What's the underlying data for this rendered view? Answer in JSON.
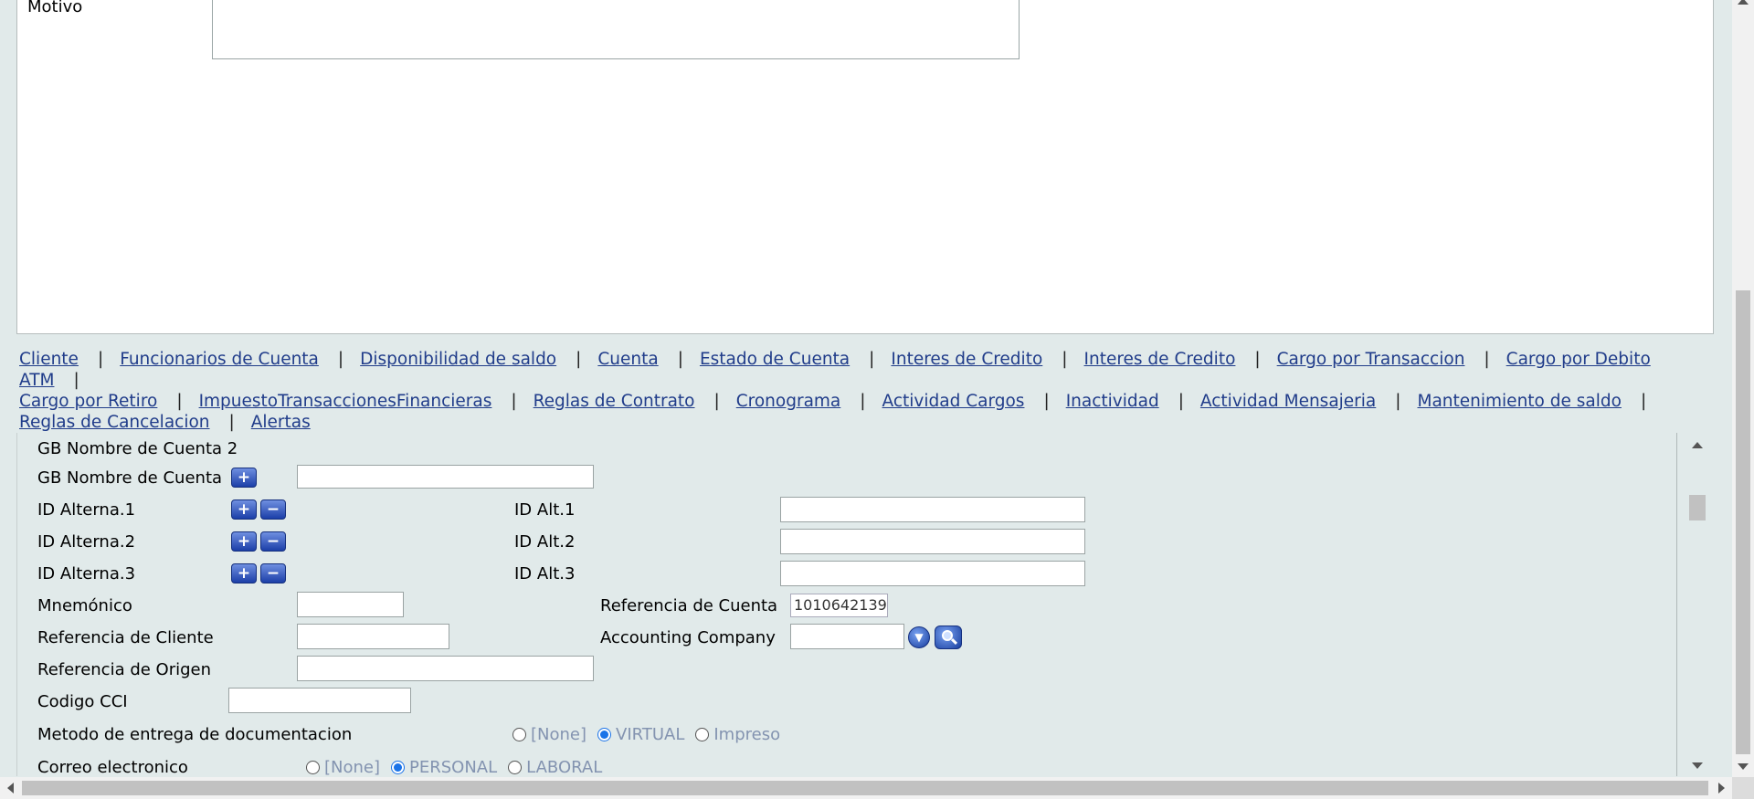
{
  "motivo": {
    "label": "Motivo",
    "value": ""
  },
  "links": [
    "Cliente",
    "Funcionarios de Cuenta",
    "Disponibilidad de saldo",
    "Cuenta",
    "Estado de Cuenta",
    "Interes de Credito",
    "Interes de Credito",
    "Cargo por Transaccion",
    "Cargo por Debito ATM",
    "Cargo por Retiro",
    "ImpuestoTransaccionesFinancieras",
    "Reglas de Contrato",
    "Cronograma",
    "Actividad Cargos",
    "Inactividad",
    "Actividad Mensajeria",
    "Mantenimiento de saldo",
    "Reglas de Cancelacion",
    "Alertas"
  ],
  "link_separator": "|",
  "form": {
    "gb_nombre_cuenta_2": "GB Nombre de Cuenta 2",
    "gb_nombre_cuenta": {
      "label": "GB Nombre de Cuenta",
      "value": ""
    },
    "id_alterna_1": {
      "label": "ID Alterna.1",
      "alt_label": "ID Alt.1",
      "value": ""
    },
    "id_alterna_2": {
      "label": "ID Alterna.2",
      "alt_label": "ID Alt.2",
      "value": ""
    },
    "id_alterna_3": {
      "label": "ID Alterna.3",
      "alt_label": "ID Alt.3",
      "value": ""
    },
    "mnemonico": {
      "label": "Mnemónico",
      "value": ""
    },
    "referencia_cuenta": {
      "label": "Referencia de Cuenta",
      "value": "1010642139"
    },
    "referencia_cliente": {
      "label": "Referencia de Cliente",
      "value": ""
    },
    "accounting_company": {
      "label": "Accounting Company",
      "value": ""
    },
    "referencia_origen": {
      "label": "Referencia de Origen",
      "value": ""
    },
    "codigo_cci": {
      "label": "Codigo CCI",
      "value": ""
    },
    "metodo_entrega": {
      "label": "Metodo de entrega de documentacion",
      "options": [
        "[None]",
        "VIRTUAL",
        "Impreso"
      ],
      "selected": "VIRTUAL"
    },
    "correo": {
      "label": "Correo electronico",
      "options": [
        "[None]",
        "PERSONAL",
        "LABORAL"
      ],
      "selected": "PERSONAL"
    }
  },
  "icons": {
    "add": "plus-icon",
    "remove": "minus-icon",
    "dropdown": "chevron-down-icon",
    "search": "search-icon"
  },
  "colors": {
    "background": "#e1eaea",
    "link": "#203c8a",
    "button": "#1c3fa8",
    "radio_selected": "#1a73e8",
    "radio_text": "#8393b0"
  }
}
